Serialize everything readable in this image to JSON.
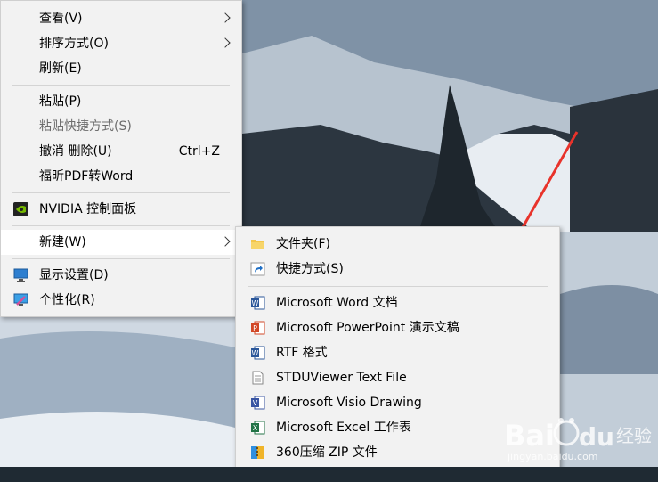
{
  "main_menu": {
    "items": [
      {
        "label": "查看(V)"
      },
      {
        "label": "排序方式(O)"
      },
      {
        "label": "刷新(E)"
      },
      {
        "label": "粘贴(P)"
      },
      {
        "label": "粘贴快捷方式(S)"
      },
      {
        "label": "撤消 删除(U)",
        "shortcut": "Ctrl+Z"
      },
      {
        "label": "福昕PDF转Word"
      },
      {
        "label": "NVIDIA 控制面板",
        "icon": "nvidia-icon"
      },
      {
        "label": "新建(W)"
      },
      {
        "label": "显示设置(D)",
        "icon": "display-settings-icon"
      },
      {
        "label": "个性化(R)",
        "icon": "personalize-icon"
      }
    ]
  },
  "sub_menu": {
    "items": [
      {
        "label": "文件夹(F)",
        "icon": "folder-icon"
      },
      {
        "label": "快捷方式(S)",
        "icon": "shortcut-icon"
      },
      {
        "label": "Microsoft Word 文档",
        "icon": "word-icon"
      },
      {
        "label": "Microsoft PowerPoint 演示文稿",
        "icon": "powerpoint-icon"
      },
      {
        "label": "RTF 格式",
        "icon": "rtf-icon"
      },
      {
        "label": "STDUViewer Text File",
        "icon": "text-file-icon"
      },
      {
        "label": "Microsoft Visio Drawing",
        "icon": "visio-icon"
      },
      {
        "label": "Microsoft Excel 工作表",
        "icon": "excel-icon"
      },
      {
        "label": "360压缩 ZIP 文件",
        "icon": "zip-icon"
      }
    ]
  },
  "watermark": {
    "text": "jingyan.baidu.com"
  },
  "colors": {
    "annotation_arrow": "#e8332b",
    "menu_bg": "#f2f2f2",
    "hover_bg": "#ffffff"
  }
}
